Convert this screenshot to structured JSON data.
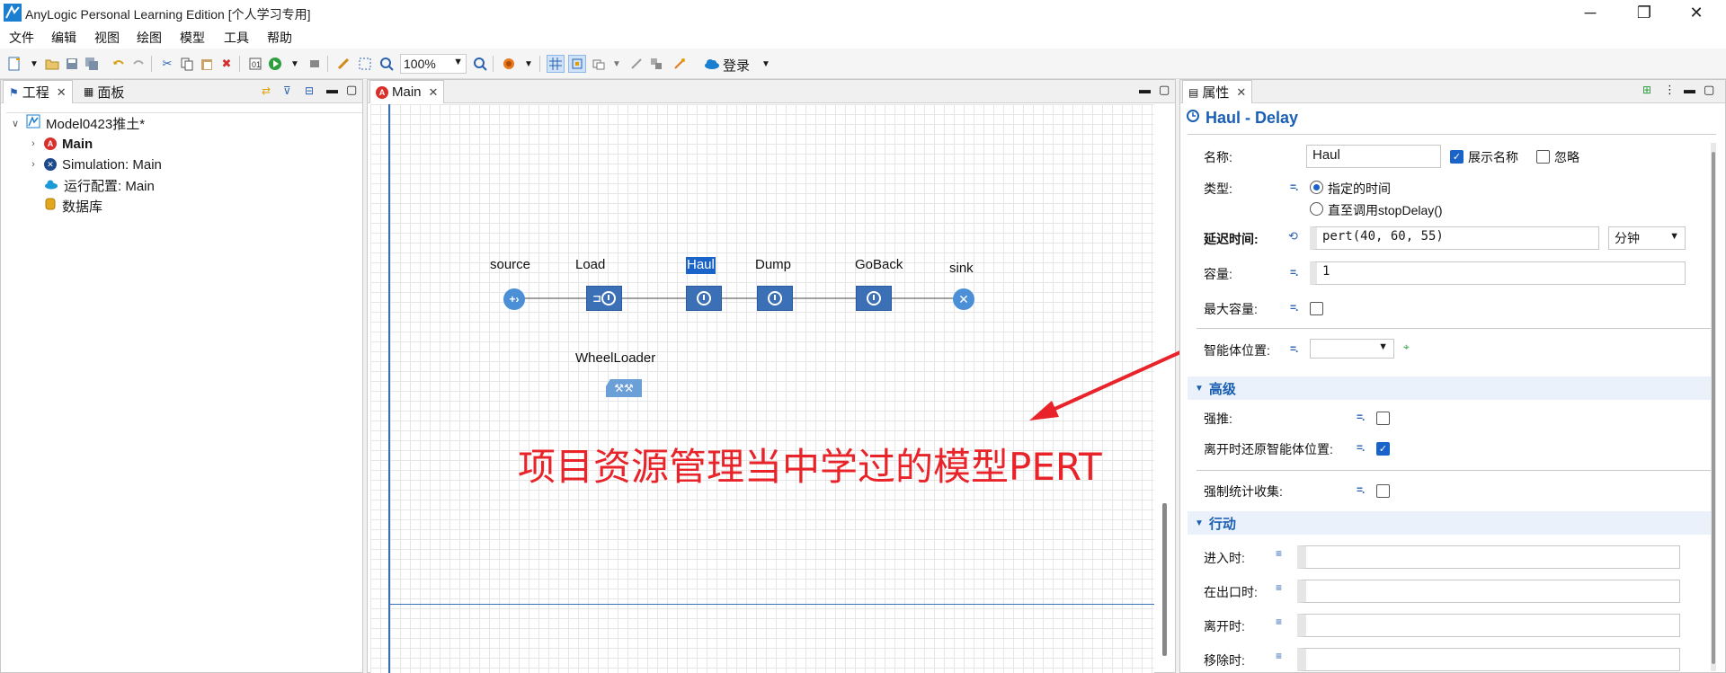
{
  "window": {
    "title": "AnyLogic Personal Learning Edition [个人学习专用]",
    "minimize": "─",
    "maximize": "❐",
    "close": "✕"
  },
  "menu": [
    "文件",
    "编辑",
    "视图",
    "绘图",
    "模型",
    "工具",
    "帮助"
  ],
  "toolbar": {
    "zoom": "100%",
    "login": "登录"
  },
  "left_panel": {
    "tabs": [
      "工程",
      "面板"
    ],
    "tree": [
      {
        "label": "Model0423推土*",
        "icon": "model-icon"
      },
      {
        "label": "Main",
        "icon": "agent-icon"
      },
      {
        "label": "Simulation: Main",
        "icon": "experiment-icon"
      },
      {
        "label": "运行配置: Main",
        "icon": "run-config-icon"
      },
      {
        "label": "数据库",
        "icon": "database-icon"
      }
    ]
  },
  "editor": {
    "tab": "Main",
    "blocks": {
      "source": "source",
      "load": "Load",
      "haul": "Haul",
      "dump": "Dump",
      "goback": "GoBack",
      "sink": "sink",
      "resource": "WheelLoader"
    },
    "annotation": "项目资源管理当中学过的模型PERT",
    "annotation_color": "#e8242a"
  },
  "properties": {
    "tab": "属性",
    "header": "Haul - Delay",
    "name_label": "名称:",
    "name_value": "Haul",
    "show_name": "展示名称",
    "ignore": "忽略",
    "type_label": "类型:",
    "type_opt1": "指定的时间",
    "type_opt2": "直至调用stopDelay()",
    "delay_label": "延迟时间:",
    "delay_value": "pert(40, 60, 55)",
    "delay_unit": "分钟",
    "capacity_label": "容量:",
    "capacity_value": "1",
    "max_capacity_label": "最大容量:",
    "agent_location_label": "智能体位置:",
    "advanced": "高级",
    "push_label": "强推:",
    "restore_label": "离开时还原智能体位置:",
    "stats_label": "强制统计收集:",
    "actions": "行动",
    "on_enter": "进入时:",
    "on_at_exit": "在出口时:",
    "on_exit": "离开时:",
    "on_remove": "移除时:"
  },
  "colors": {
    "accent": "#1a63c9",
    "block": "#3b6fb6",
    "arrow": "#e8242a"
  }
}
